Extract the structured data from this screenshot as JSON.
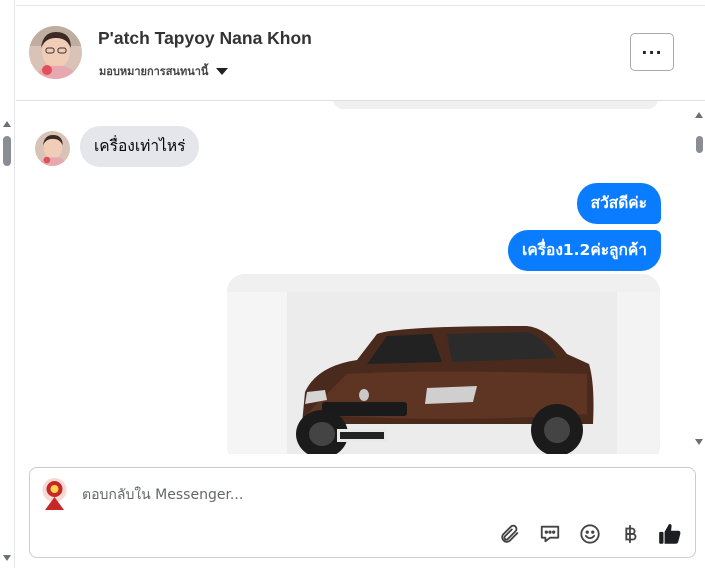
{
  "header": {
    "contact_name": "P'atch Tapyoy Nana Khon",
    "assign_label": "มอบหมายการสนทนานี้",
    "more_label": "···"
  },
  "messages": [
    {
      "direction": "in",
      "text": "เครื่องเท่าไหร่"
    },
    {
      "direction": "out",
      "text": "สวัสดีค่ะ"
    },
    {
      "direction": "out",
      "text": "เครื่อง1.2ค่ะลูกค้า"
    }
  ],
  "attachment": {
    "type": "photo",
    "subject": "brown sedan car"
  },
  "composer": {
    "placeholder": "ตอบกลับใน Messenger...",
    "icons": [
      "paperclip-icon",
      "saved-reply-icon",
      "emoji-icon",
      "baht-icon",
      "thumbs-up-icon"
    ]
  },
  "colors": {
    "outgoing_bubble": "#0a7cff",
    "incoming_bubble": "#e4e6eb",
    "like_icon": "#1c1e21"
  }
}
